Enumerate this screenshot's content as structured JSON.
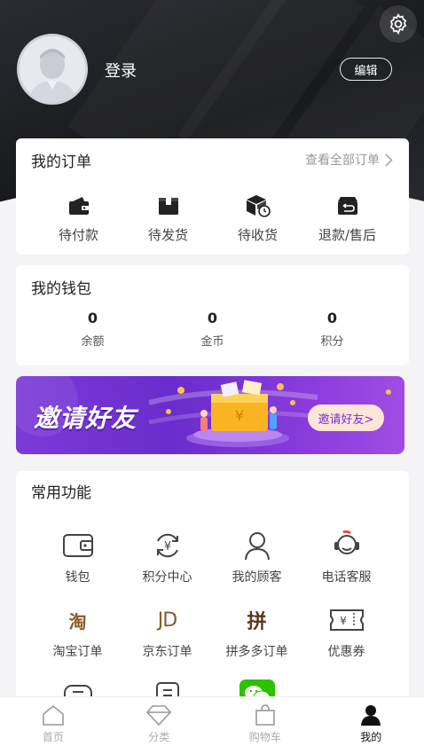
{
  "header": {
    "login_text": "登录",
    "edit_label": "编辑",
    "icons": {
      "settings": "gear-icon",
      "avatar": "avatar-placeholder"
    }
  },
  "orders": {
    "title": "我的订单",
    "view_all": "查看全部订单",
    "items": [
      {
        "label": "待付款",
        "icon": "wallet-icon"
      },
      {
        "label": "待发货",
        "icon": "box-icon"
      },
      {
        "label": "待收货",
        "icon": "package-clock-icon"
      },
      {
        "label": "退款/售后",
        "icon": "refund-icon"
      }
    ]
  },
  "wallet": {
    "title": "我的钱包",
    "items": [
      {
        "value": "0",
        "label": "余额"
      },
      {
        "value": "0",
        "label": "金币"
      },
      {
        "value": "0",
        "label": "积分"
      }
    ]
  },
  "banner": {
    "title": "邀请好友",
    "button": "邀请好友>",
    "colors": {
      "start": "#7c3ad9",
      "end": "#a04de4",
      "button_bg": "#fde6d9"
    }
  },
  "functions": {
    "title": "常用功能",
    "items": [
      {
        "label": "钱包",
        "icon": "wallet-outline-icon"
      },
      {
        "label": "积分中心",
        "icon": "yuan-cycle-icon"
      },
      {
        "label": "我的顾客",
        "icon": "user-icon"
      },
      {
        "label": "电话客服",
        "icon": "headset-icon"
      },
      {
        "label": "淘宝订单",
        "icon": "taobao-icon",
        "glyph": "淘"
      },
      {
        "label": "京东订单",
        "icon": "jd-icon",
        "glyph": "JD"
      },
      {
        "label": "拼多多订单",
        "icon": "pinduoduo-icon",
        "glyph": "拼"
      },
      {
        "label": "优惠券",
        "icon": "coupon-icon"
      },
      {
        "label": "",
        "icon": "message-icon"
      },
      {
        "label": "",
        "icon": "document-icon"
      },
      {
        "label": "",
        "icon": "wechat-icon"
      }
    ]
  },
  "tabbar": {
    "items": [
      {
        "label": "首页",
        "icon": "home-icon",
        "active": false
      },
      {
        "label": "分类",
        "icon": "diamond-icon",
        "active": false
      },
      {
        "label": "购物车",
        "icon": "shopping-bag-icon",
        "active": false
      },
      {
        "label": "我的",
        "icon": "person-icon",
        "active": true
      }
    ]
  }
}
